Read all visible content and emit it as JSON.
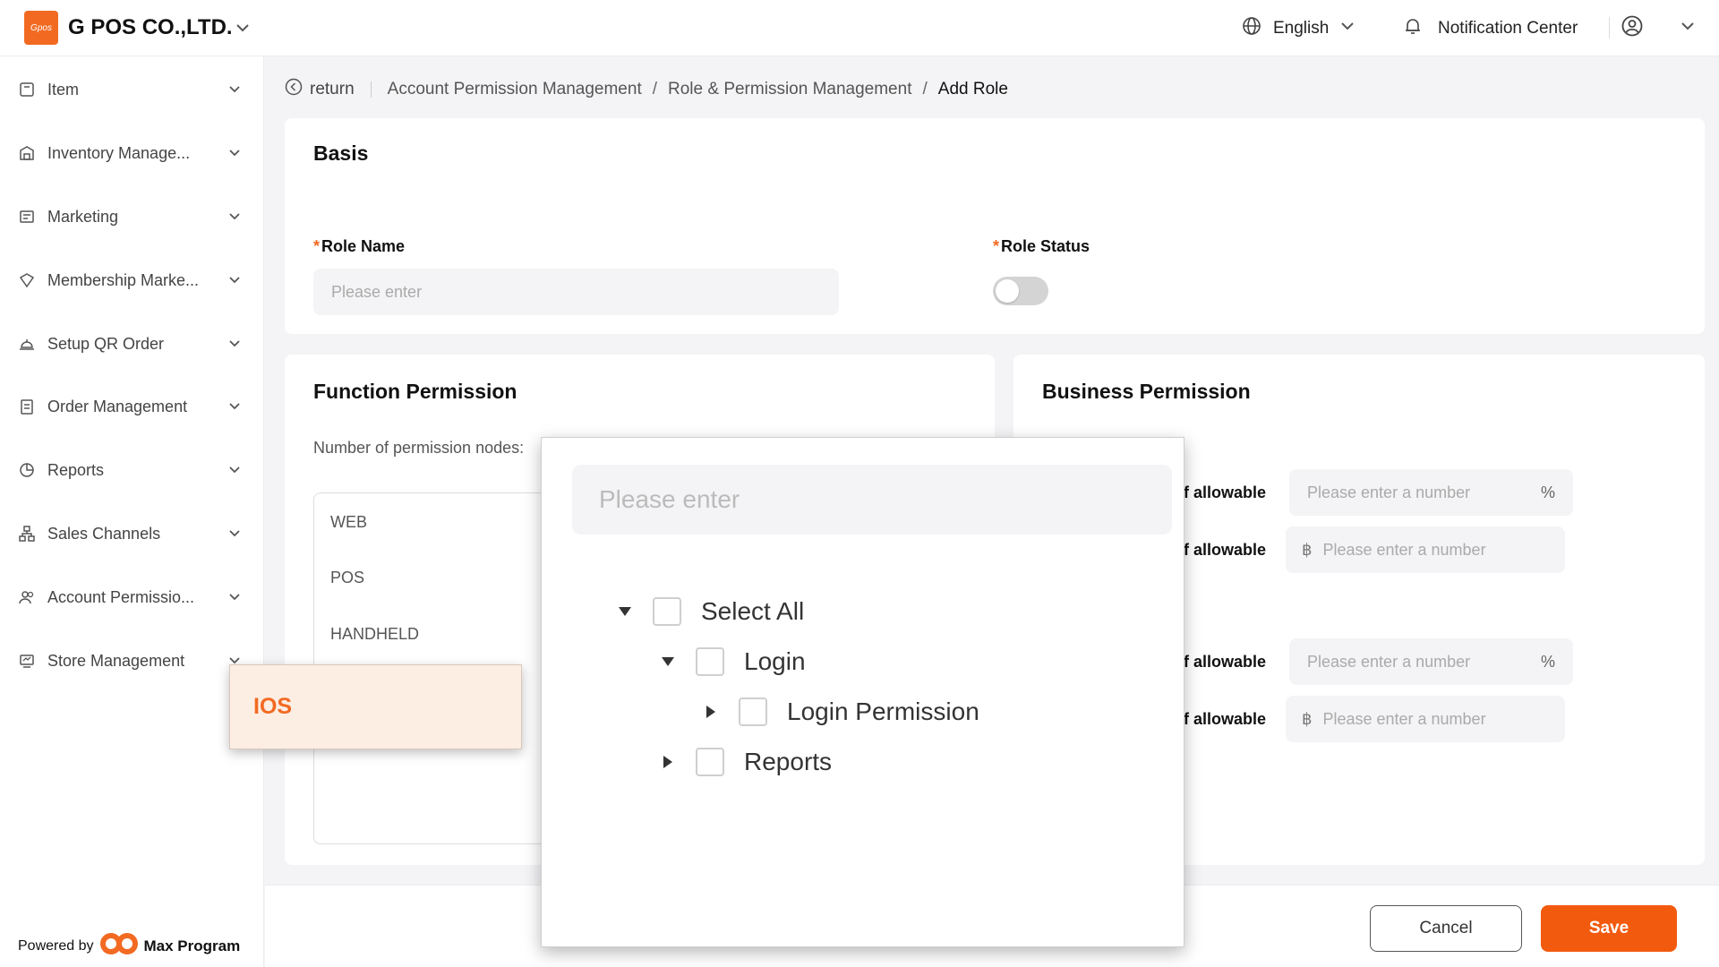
{
  "header": {
    "logo_text": "Gpos",
    "company": "G POS CO.,LTD.",
    "language": "English",
    "notification": "Notification Center"
  },
  "sidebar": {
    "items": [
      {
        "label": "Item",
        "icon": "box-icon"
      },
      {
        "label": "Inventory Manage...",
        "icon": "warehouse-icon"
      },
      {
        "label": "Marketing",
        "icon": "ticket-icon"
      },
      {
        "label": "Membership Marke...",
        "icon": "membership-icon"
      },
      {
        "label": "Setup QR Order",
        "icon": "bell-tray-icon"
      },
      {
        "label": "Order Management",
        "icon": "clipboard-icon"
      },
      {
        "label": "Reports",
        "icon": "pie-chart-icon"
      },
      {
        "label": "Sales Channels",
        "icon": "network-icon"
      },
      {
        "label": "Account Permissio...",
        "icon": "users-icon"
      },
      {
        "label": "Store Management",
        "icon": "store-icon"
      }
    ],
    "powered_by": "Powered by",
    "brand": "Max Program"
  },
  "breadcrumb": {
    "return": "return",
    "items": [
      "Account Permission Management",
      "Role & Permission Management"
    ],
    "current": "Add Role"
  },
  "basis": {
    "title": "Basis",
    "role_name_label": "Role Name",
    "role_name_placeholder": "Please enter",
    "role_status_label": "Role Status",
    "required_mark": "*"
  },
  "function_permission": {
    "title": "Function Permission",
    "nodes_label": "Number of permission nodes:",
    "platforms": [
      "WEB",
      "POS",
      "HANDHELD"
    ]
  },
  "business_permission": {
    "title": "Business Permission",
    "rows": [
      {
        "label": "ff allowable",
        "placeholder": "Please enter a number",
        "suffix": "%"
      },
      {
        "label": "ff allowable",
        "placeholder": "Please enter a number",
        "prefix": "฿"
      },
      {
        "label": "ff allowable",
        "placeholder": "Please enter a number",
        "suffix": "%"
      },
      {
        "label": "ff allowable",
        "placeholder": "Please enter a number",
        "prefix": "฿"
      }
    ]
  },
  "ios_popup": {
    "label": "IOS"
  },
  "tree_popup": {
    "search_placeholder": "Please enter",
    "nodes": [
      {
        "label": "Select All",
        "level": 0,
        "expanded": true
      },
      {
        "label": "Login",
        "level": 1,
        "expanded": true
      },
      {
        "label": "Login Permission",
        "level": 2,
        "expanded": false
      },
      {
        "label": "Reports",
        "level": 1,
        "expanded": false
      }
    ]
  },
  "footer": {
    "cancel": "Cancel",
    "save": "Save"
  },
  "colors": {
    "accent": "#f26a22",
    "save": "#f25a0e"
  }
}
